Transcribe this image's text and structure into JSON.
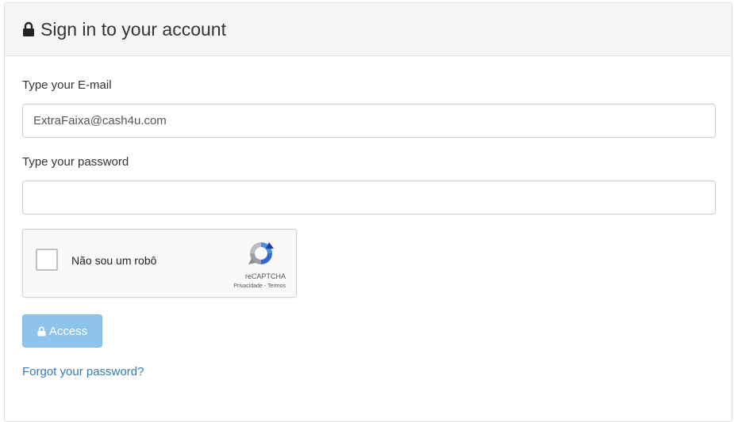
{
  "header": {
    "title": "Sign in to your account",
    "icon": "lock-icon"
  },
  "form": {
    "email_label": "Type your E-mail",
    "email_value": "ExtraFaixa@cash4u.com",
    "password_label": "Type your password",
    "password_value": ""
  },
  "recaptcha": {
    "label": "Não sou um robô",
    "checked": false,
    "brand": "reCAPTCHA",
    "links": "Privacidade - Termos"
  },
  "actions": {
    "access_label": "Access",
    "forgot_label": "Forgot your password?"
  },
  "colors": {
    "button": "#8ec4ec",
    "link": "#337ab7",
    "heading_bg": "#f5f5f5"
  }
}
